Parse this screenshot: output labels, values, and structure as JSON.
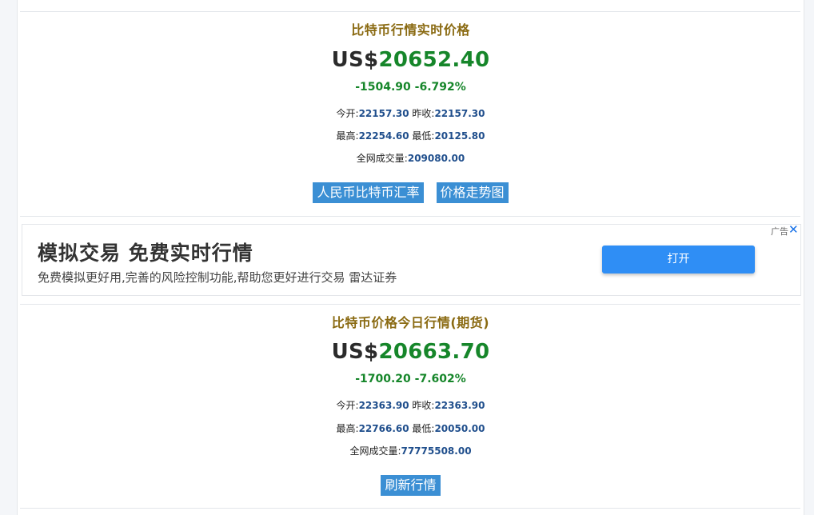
{
  "section1": {
    "title": "比特币行情实时价格",
    "currency": "US$",
    "price": "20652.40",
    "change": "-1504.90 -6.792%",
    "open_label": "今开:",
    "open_value": "22157.30",
    "prev_label": " 昨收:",
    "prev_value": "22157.30",
    "high_label": "最高:",
    "high_value": "22254.60",
    "low_label": " 最低:",
    "low_value": "20125.80",
    "volume_label": "全网成交量:",
    "volume_value": "209080.00",
    "button_cny": "人民币比特币汇率",
    "button_chart": "价格走势图"
  },
  "ad": {
    "title": "模拟交易 免费实时行情",
    "desc": "免费模拟更好用,完善的风险控制功能,帮助您更好进行交易 雷达证券",
    "open_button": "打开",
    "label": "广告",
    "close_icon": "close-icon"
  },
  "section2": {
    "title": "比特币价格今日行情(期货)",
    "currency": "US$",
    "price": "20663.70",
    "change": "-1700.20 -7.602%",
    "open_label": "今开:",
    "open_value": "22363.90",
    "prev_label": " 昨收:",
    "prev_value": "22363.90",
    "high_label": "最高:",
    "high_value": "22766.60",
    "low_label": " 最低:",
    "low_value": "20050.00",
    "volume_label": "全网成交量:",
    "volume_value": "77775508.00",
    "button_refresh": "刷新行情"
  },
  "colors": {
    "title": "#8a6a12",
    "positive_green": "#16862a",
    "stat_value": "#1f4e8c",
    "button_blue": "#3b8fd4",
    "ad_button": "#2f8ef5"
  }
}
